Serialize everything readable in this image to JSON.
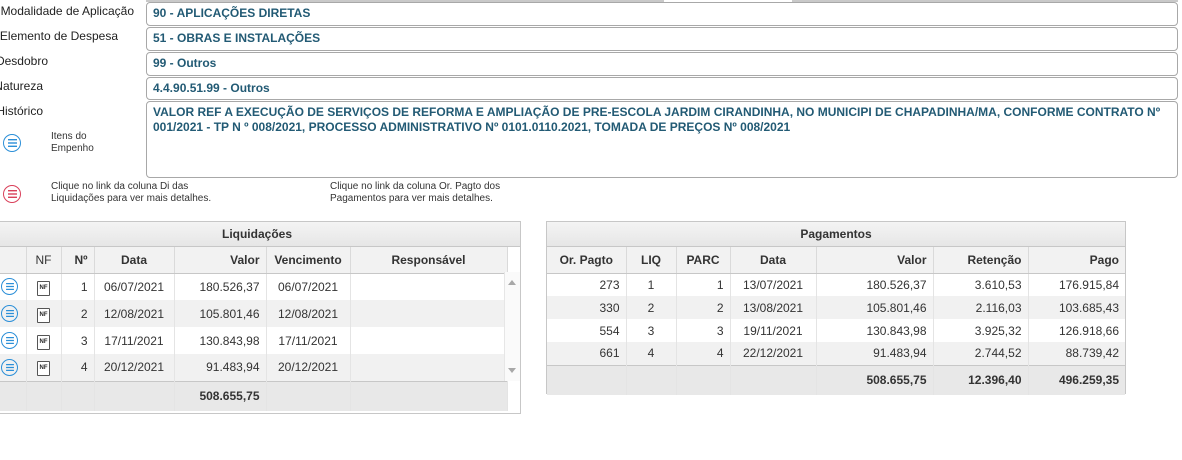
{
  "form": {
    "modalidade": {
      "label": "Modalidade de Aplicação",
      "value": "90 - APLICAÇÕES DIRETAS"
    },
    "elemento": {
      "label": "Elemento de Despesa",
      "value": "51 - OBRAS E INSTALAÇÕES"
    },
    "desdobro": {
      "label": "Desdobro",
      "value": "99 - Outros"
    },
    "natureza": {
      "label": "Natureza",
      "value": "4.4.90.51.99 - Outros"
    },
    "historico": {
      "label": "Histórico",
      "value": "VALOR REF A EXECUÇÃO DE SERVIÇOS DE REFORMA E AMPLIAÇÃO DE PRE-ESCOLA JARDIM CIRANDINHA, NO MUNICIPI DE CHAPADINHA/MA, CONFORME CONTRATO Nº 001/2021 - TP N º 008/2021, PROCESSO ADMINISTRATIVO Nº 0101.0110.2021, TOMADA DE PREÇOS Nº 008/2021"
    }
  },
  "itens_link": {
    "line1": "Itens do",
    "line2": "Empenho",
    "icon": "list-icon"
  },
  "hints": {
    "liq_line1": "Clique no link da coluna Di das",
    "liq_line2": "Liquidações para ver mais detalhes.",
    "pag_line1": "Clique no link da coluna Or. Pagto dos",
    "pag_line2": "Pagamentos para ver mais detalhes."
  },
  "liquidacoes": {
    "title": "Liquidações",
    "columns": [
      "NF",
      "Nº",
      "Data",
      "Valor",
      "Vencimento",
      "Responsável"
    ],
    "rows": [
      {
        "n": "1",
        "data": "06/07/2021",
        "valor": "180.526,37",
        "vencimento": "06/07/2021",
        "responsavel": ""
      },
      {
        "n": "2",
        "data": "12/08/2021",
        "valor": "105.801,46",
        "vencimento": "12/08/2021",
        "responsavel": ""
      },
      {
        "n": "3",
        "data": "17/11/2021",
        "valor": "130.843,98",
        "vencimento": "17/11/2021",
        "responsavel": ""
      },
      {
        "n": "4",
        "data": "20/12/2021",
        "valor": "91.483,94",
        "vencimento": "20/12/2021",
        "responsavel": ""
      }
    ],
    "total": "508.655,75",
    "nf_icon_text": "NF"
  },
  "pagamentos": {
    "title": "Pagamentos",
    "columns": [
      "Or. Pagto",
      "LIQ",
      "PARC",
      "Data",
      "Valor",
      "Retenção",
      "Pago"
    ],
    "rows": [
      {
        "or": "273",
        "liq": "1",
        "parc": "1",
        "data": "13/07/2021",
        "valor": "180.526,37",
        "retencao": "3.610,53",
        "pago": "176.915,84"
      },
      {
        "or": "330",
        "liq": "2",
        "parc": "2",
        "data": "13/08/2021",
        "valor": "105.801,46",
        "retencao": "2.116,03",
        "pago": "103.685,43"
      },
      {
        "or": "554",
        "liq": "3",
        "parc": "3",
        "data": "19/11/2021",
        "valor": "130.843,98",
        "retencao": "3.925,32",
        "pago": "126.918,66"
      },
      {
        "or": "661",
        "liq": "4",
        "parc": "4",
        "data": "22/12/2021",
        "valor": "91.483,94",
        "retencao": "2.744,52",
        "pago": "88.739,42"
      }
    ],
    "total_valor": "508.655,75",
    "total_retencao": "12.396,40",
    "total_pago": "496.259,35"
  },
  "colors": {
    "accent_blue": "#2b8fd8",
    "accent_red": "#d9405a",
    "value_text": "#225a74"
  }
}
